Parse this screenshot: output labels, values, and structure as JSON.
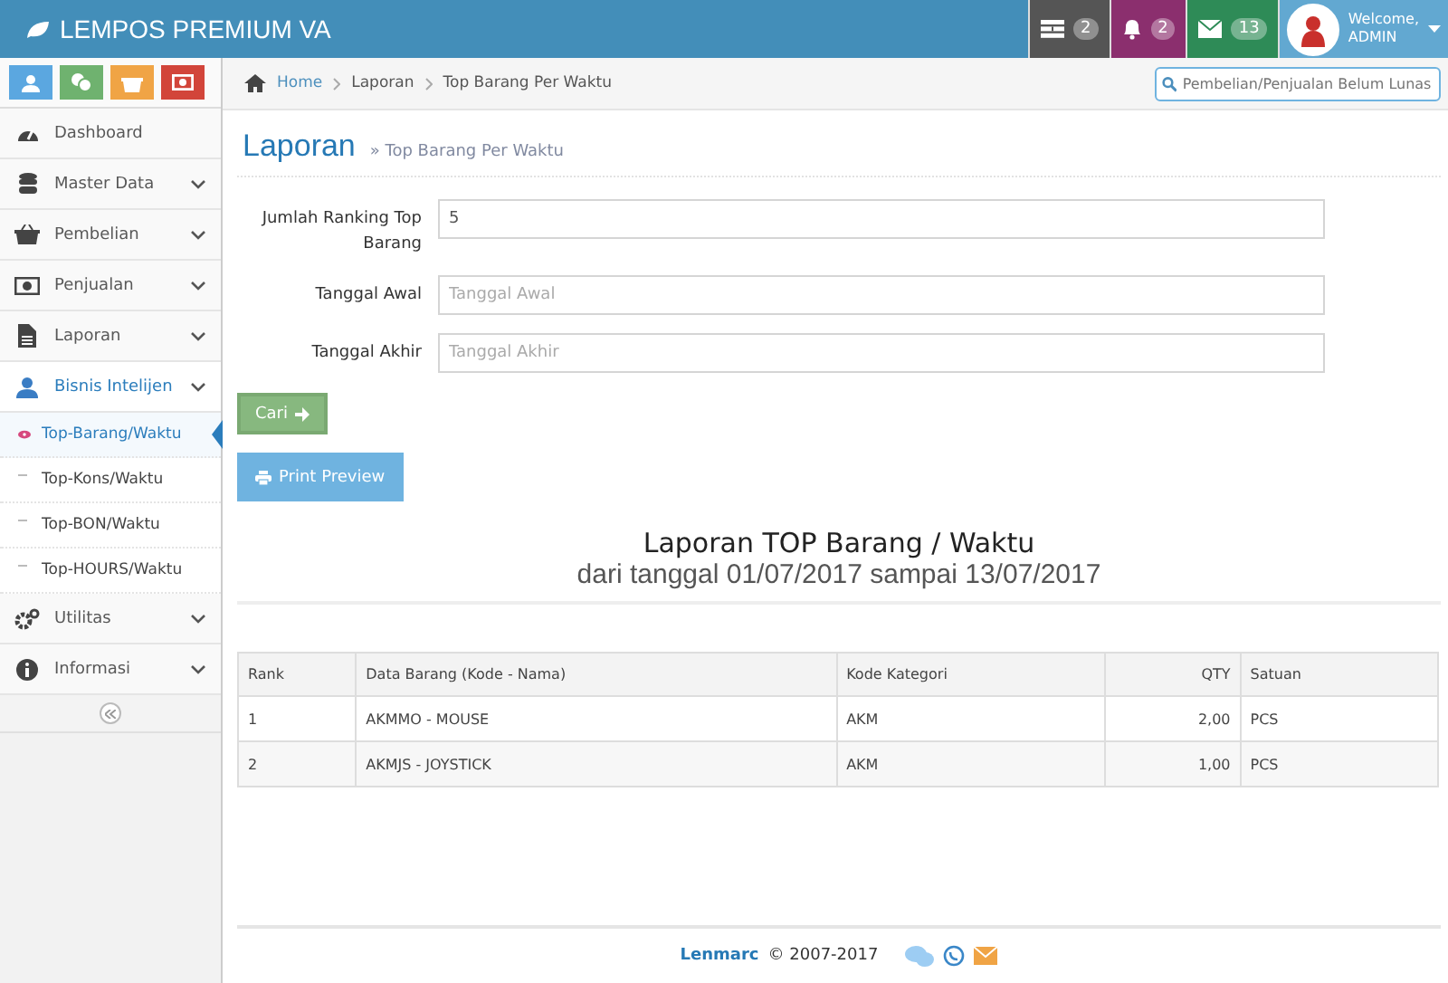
{
  "header": {
    "title": "LEMPOS PREMIUM VA",
    "notifications": [
      {
        "kind": "tasks",
        "count": "2",
        "color": "#555555"
      },
      {
        "kind": "bell",
        "count": "2",
        "color": "#8b2f6e"
      },
      {
        "kind": "mail",
        "count": "13",
        "color": "#2e8b57"
      }
    ],
    "user": {
      "greeting": "Welcome,",
      "name": "ADMIN"
    }
  },
  "shortcuts": [
    {
      "kind": "users",
      "color": "#5ba7e0"
    },
    {
      "kind": "coins",
      "color": "#6fb26f"
    },
    {
      "kind": "basket",
      "color": "#f0a445"
    },
    {
      "kind": "money",
      "color": "#d2453a"
    }
  ],
  "sidebar": {
    "items": [
      {
        "kind": "dashboard",
        "label": "Dashboard"
      },
      {
        "kind": "database",
        "label": "Master Data",
        "expanded": false
      },
      {
        "kind": "basket",
        "label": "Pembelian",
        "expanded": false
      },
      {
        "kind": "money",
        "label": "Penjualan",
        "expanded": false
      },
      {
        "kind": "file",
        "label": "Laporan",
        "expanded": false
      },
      {
        "kind": "user",
        "label": "Bisnis Intelijen",
        "expanded": true,
        "children": [
          {
            "label": "Top-Barang/Waktu",
            "selected": true
          },
          {
            "label": "Top-Kons/Waktu",
            "selected": false
          },
          {
            "label": "Top-BON/Waktu",
            "selected": false
          },
          {
            "label": "Top-HOURS/Waktu",
            "selected": false
          }
        ]
      },
      {
        "kind": "gears",
        "label": "Utilitas",
        "expanded": false
      },
      {
        "kind": "info",
        "label": "Informasi",
        "expanded": false
      }
    ]
  },
  "breadcrumb": [
    "Home",
    "Laporan",
    "Top Barang Per Waktu"
  ],
  "search": {
    "placeholder": "Pembelian/Penjualan Belum Lunas"
  },
  "page": {
    "title": "Laporan",
    "subtitle": "» Top Barang Per Waktu"
  },
  "form": [
    {
      "label": "Jumlah Ranking Top Barang",
      "value": "5"
    },
    {
      "label": "Tanggal Awal",
      "placeholder": "Tanggal Awal"
    },
    {
      "label": "Tanggal Akhir",
      "placeholder": "Tanggal Akhir"
    }
  ],
  "buttons": {
    "search": "Cari",
    "print": "Print Preview"
  },
  "report": {
    "title": "Laporan TOP Barang / Waktu",
    "subtitle": "dari tanggal 01/07/2017 sampai 13/07/2017"
  },
  "table": {
    "columns": [
      "Rank",
      "Data Barang (Kode - Nama)",
      "Kode Kategori",
      "QTY",
      "Satuan"
    ],
    "rows": [
      [
        "1",
        "AKMMO - MOUSE",
        "AKM",
        "2,00",
        "PCS"
      ],
      [
        "2",
        "AKMJS - JOYSTICK",
        "AKM",
        "1,00",
        "PCS"
      ]
    ]
  },
  "footer": {
    "brand": "Lenmarc",
    "text": "© 2007-2017"
  }
}
